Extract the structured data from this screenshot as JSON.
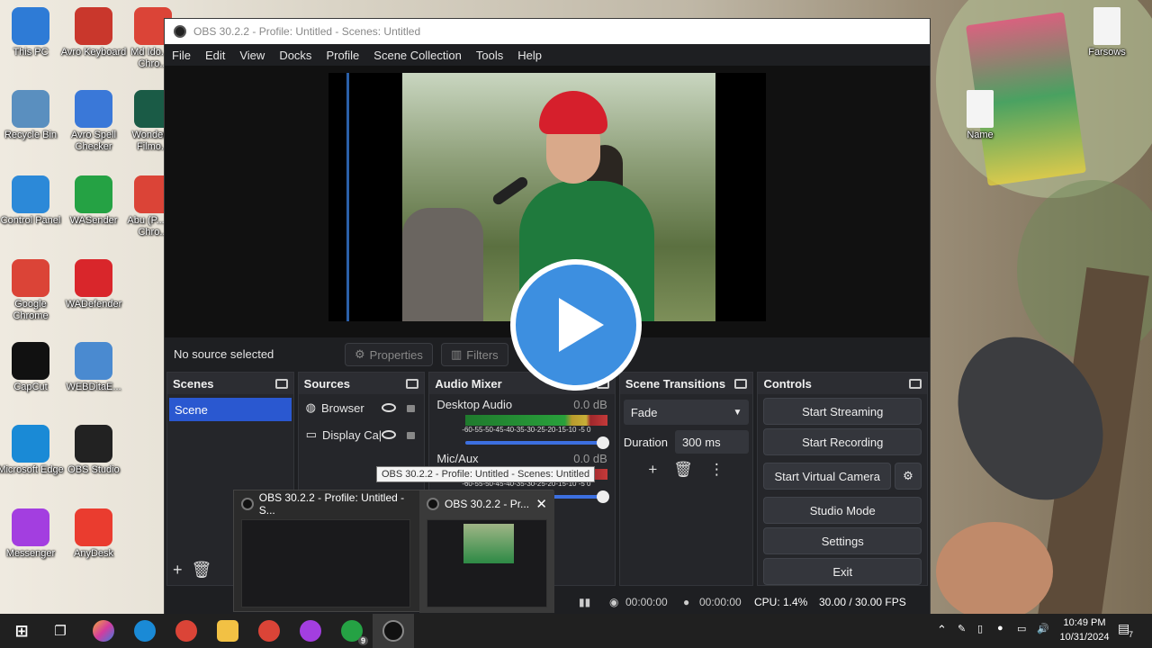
{
  "desktop": {
    "icons_left": [
      {
        "label": "This PC",
        "icon": "pc-icon",
        "color": "#2e7bd6"
      },
      {
        "label": "Recycle Bin",
        "icon": "recycle-bin-icon",
        "color": "#5a8fbf"
      },
      {
        "label": "Control Panel",
        "icon": "control-panel-icon",
        "color": "#2c89d8"
      },
      {
        "label": "Google Chrome",
        "icon": "chrome-icon",
        "color": "#db4437"
      },
      {
        "label": "CapCut",
        "icon": "capcut-icon",
        "color": "#111111"
      },
      {
        "label": "Microsoft Edge",
        "icon": "edge-icon",
        "color": "#1a8ad6"
      },
      {
        "label": "Messenger",
        "icon": "messenger-icon",
        "color": "#a33ee0"
      }
    ],
    "icons_mid": [
      {
        "label": "Avro Keyboard",
        "icon": "avro-keyboard-icon",
        "color": "#c9372c"
      },
      {
        "label": "Avro Spell Checker",
        "icon": "avro-spell-icon",
        "color": "#3a78d8"
      },
      {
        "label": "WASender",
        "icon": "wasender-icon",
        "color": "#25a244"
      },
      {
        "label": "WADefender",
        "icon": "wadefender-icon",
        "color": "#d9262b"
      },
      {
        "label": "WEBDitaE...",
        "icon": "download-icon",
        "color": "#4a8ad0"
      },
      {
        "label": "OBS Studio",
        "icon": "obs-icon",
        "color": "#222222"
      },
      {
        "label": "AnyDesk",
        "icon": "anydesk-icon",
        "color": "#ea3c2f"
      }
    ],
    "icons_right_col": [
      {
        "label": "Md Ido... - Chro...",
        "icon": "chrome-icon",
        "color": "#db4437"
      },
      {
        "label": "Wonder... Filmo...",
        "icon": "filmora-icon",
        "color": "#1a5b46"
      },
      {
        "label": "Abu (P... i) - Chro...",
        "icon": "chrome-icon",
        "color": "#db4437"
      }
    ],
    "icons_far_right": [
      {
        "label": "Farsows",
        "icon": "document-icon"
      },
      {
        "label": "Name",
        "icon": "document-icon"
      }
    ]
  },
  "obs": {
    "title": "OBS 30.2.2 - Profile: Untitled - Scenes: Untitled",
    "menu": [
      "File",
      "Edit",
      "View",
      "Docks",
      "Profile",
      "Scene Collection",
      "Tools",
      "Help"
    ],
    "no_source": "No source selected",
    "properties": "Properties",
    "filters": "Filters",
    "scenes": {
      "title": "Scenes",
      "items": [
        "Scene"
      ]
    },
    "sources": {
      "title": "Sources",
      "items": [
        "Browser",
        "Display Ca|"
      ]
    },
    "mixer": {
      "title": "Audio Mixer",
      "channels": [
        {
          "name": "Desktop Audio",
          "db": "0.0 dB",
          "scale": "-60-55-50-45-40-35-30-25-20-15-10 -5 0"
        },
        {
          "name": "Mic/Aux",
          "db": "0.0 dB",
          "scale": "-60-55-50-45-40-35-30-25-20-15-10 -5 0"
        }
      ]
    },
    "transitions": {
      "title": "Scene Transitions",
      "type": "Fade",
      "duration_label": "Duration",
      "duration": "300 ms"
    },
    "controls": {
      "title": "Controls",
      "start_streaming": "Start Streaming",
      "start_recording": "Start Recording",
      "start_virtual_camera": "Start Virtual Camera",
      "studio_mode": "Studio Mode",
      "settings": "Settings",
      "exit": "Exit"
    },
    "status": {
      "stream_time": "00:00:00",
      "rec_time": "00:00:00",
      "cpu": "CPU: 1.4%",
      "fps": "30.00 / 30.00 FPS"
    }
  },
  "tooltip": "OBS 30.2.2 - Profile: Untitled - Scenes: Untitled",
  "thumbnails": [
    {
      "title": "OBS 30.2.2 - Profile: Untitled - S..."
    },
    {
      "title": "OBS 30.2.2 - Pr..."
    }
  ],
  "taskbar": {
    "time": "10:49 PM",
    "date": "10/31/2024",
    "whatsapp_badge": "9",
    "notification_count": "7"
  }
}
